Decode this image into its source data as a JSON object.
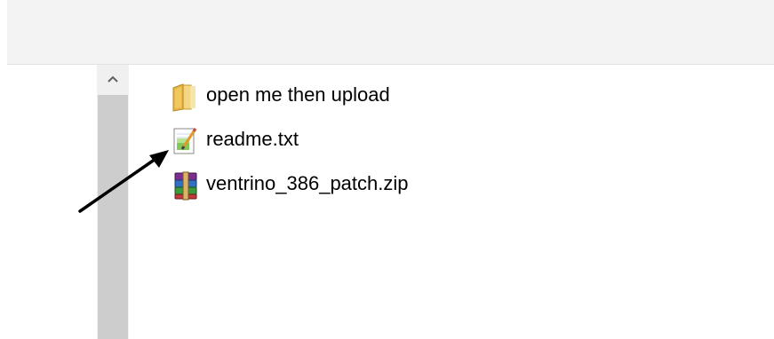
{
  "files": [
    {
      "name": "open me then upload",
      "icon": "folder-icon"
    },
    {
      "name": "readme.txt",
      "icon": "text-file-icon"
    },
    {
      "name": "ventrino_386_patch.zip",
      "icon": "winrar-archive-icon"
    }
  ],
  "colors": {
    "folder": "#e8b84a",
    "arrow": "#000000",
    "scrollbar_track": "#f0f0f0",
    "scrollbar_thumb": "#cdcdcd"
  }
}
